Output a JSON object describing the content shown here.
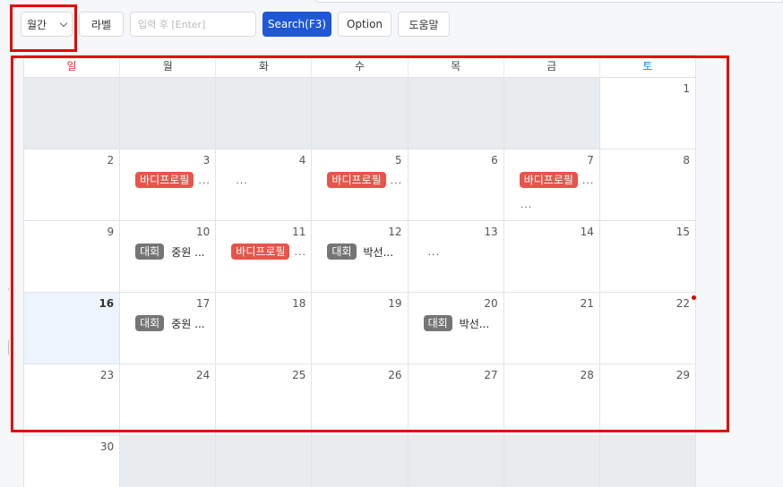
{
  "toolbar": {
    "view_select": "월간",
    "label_button": "라벨",
    "search_placeholder": "입력 후 [Enter]",
    "search_button": "Search(F3)",
    "option_button": "Option",
    "help_button": "도움말"
  },
  "calendar": {
    "weekdays": [
      "일",
      "월",
      "화",
      "수",
      "목",
      "금",
      "토"
    ],
    "weeks": [
      [
        {
          "num": "",
          "outside": true
        },
        {
          "num": "",
          "outside": true
        },
        {
          "num": "",
          "outside": true
        },
        {
          "num": "",
          "outside": true
        },
        {
          "num": "",
          "outside": true
        },
        {
          "num": "",
          "outside": true
        },
        {
          "num": "1"
        }
      ],
      [
        {
          "num": "2"
        },
        {
          "num": "3",
          "events": [
            {
              "badge": "바디프로필",
              "color": "red",
              "more": "..."
            }
          ]
        },
        {
          "num": "4",
          "more_only": "..."
        },
        {
          "num": "5",
          "events": [
            {
              "badge": "바디프로필",
              "color": "red",
              "more": "..."
            }
          ]
        },
        {
          "num": "6"
        },
        {
          "num": "7",
          "events": [
            {
              "badge": "바디프로필",
              "color": "red",
              "more": "..."
            }
          ],
          "more_row2": "..."
        },
        {
          "num": "8"
        }
      ],
      [
        {
          "num": "9"
        },
        {
          "num": "10",
          "events": [
            {
              "badge": "대회",
              "color": "gray",
              "text": "중원 ..."
            }
          ]
        },
        {
          "num": "11",
          "events": [
            {
              "badge": "바디프로필",
              "color": "red",
              "more": "..."
            }
          ]
        },
        {
          "num": "12",
          "events": [
            {
              "badge": "대회",
              "color": "gray",
              "text": "박선..."
            }
          ]
        },
        {
          "num": "13",
          "more_only": "..."
        },
        {
          "num": "14"
        },
        {
          "num": "15"
        }
      ],
      [
        {
          "num": "16",
          "today": true
        },
        {
          "num": "17",
          "events": [
            {
              "badge": "대회",
              "color": "gray",
              "text": "중원 ..."
            }
          ]
        },
        {
          "num": "18"
        },
        {
          "num": "19"
        },
        {
          "num": "20",
          "events": [
            {
              "badge": "대회",
              "color": "gray",
              "text": "박선..."
            }
          ]
        },
        {
          "num": "21"
        },
        {
          "num": "22"
        }
      ],
      [
        {
          "num": "23"
        },
        {
          "num": "24"
        },
        {
          "num": "25"
        },
        {
          "num": "26"
        },
        {
          "num": "27"
        },
        {
          "num": "28"
        },
        {
          "num": "29"
        }
      ],
      [
        {
          "num": "30"
        },
        {
          "num": "",
          "outside": true
        },
        {
          "num": "",
          "outside": true
        },
        {
          "num": "",
          "outside": true
        },
        {
          "num": "",
          "outside": true
        },
        {
          "num": "",
          "outside": true
        },
        {
          "num": "",
          "outside": true
        }
      ]
    ]
  },
  "colors": {
    "accent": "#1f57d6",
    "highlight": "#e60000",
    "badge_red": "#e8544b",
    "badge_gray": "#757575",
    "sunday": "#e03131",
    "saturday": "#1c7ed6"
  }
}
